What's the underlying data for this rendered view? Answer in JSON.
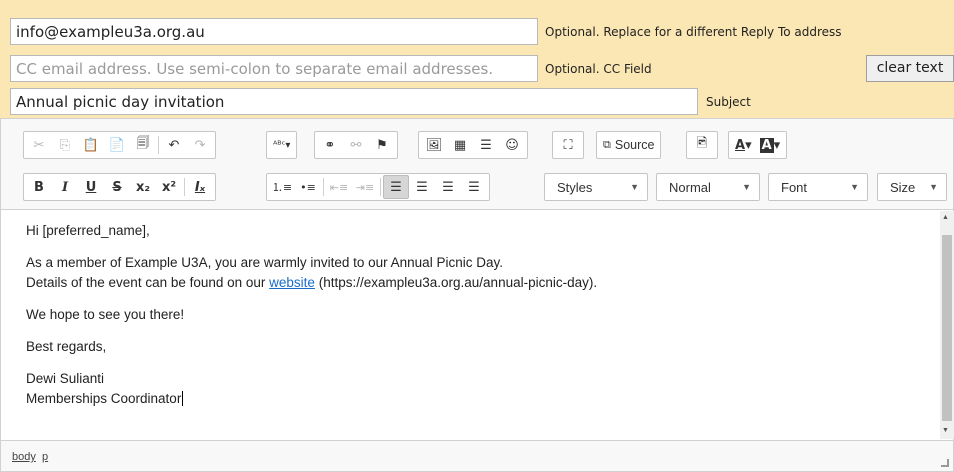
{
  "reply_to": {
    "value": "info@exampleu3a.org.au",
    "hint": "Optional. Replace for a different Reply To address"
  },
  "cc": {
    "placeholder": "CC email address. Use semi-colon to separate email addresses.",
    "hint": "Optional. CC Field"
  },
  "clear_button": "clear text",
  "subject": {
    "value": "Annual picnic day invitation",
    "hint": "Subject"
  },
  "toolbar": {
    "icons_row1": [
      "cut-icon",
      "copy-icon",
      "paste-icon",
      "paste-text-icon",
      "paste-word-icon",
      "undo-icon",
      "redo-icon",
      "spellcheck-icon",
      "link-icon",
      "unlink-icon",
      "anchor-icon",
      "image-icon",
      "table-icon",
      "horizontal-rule-icon",
      "smiley-icon",
      "maximize-icon",
      "source-icon",
      "image-edit-icon",
      "text-color-icon",
      "background-color-icon"
    ],
    "source_label": "Source",
    "icons_row2": [
      "bold-icon",
      "italic-icon",
      "underline-icon",
      "strike-icon",
      "subscript-icon",
      "superscript-icon",
      "remove-format-icon",
      "numbered-list-icon",
      "bulleted-list-icon",
      "outdent-icon",
      "indent-icon",
      "align-left-icon",
      "align-center-icon",
      "align-right-icon",
      "justify-icon"
    ],
    "styles_label": "Styles",
    "format_label": "Normal",
    "font_label": "Font",
    "size_label": "Size"
  },
  "content": {
    "greeting": "Hi [preferred_name],",
    "para1_line1": "As a member of Example U3A, you are warmly invited to our Annual Picnic Day.",
    "para1_line2_before": "Details of the event can be found on our ",
    "link_text": "website",
    "para1_line2_after": " (https://exampleu3a.org.au/annual-picnic-day).",
    "para2": "We hope to see you there!",
    "closing": "Best regards,",
    "signature_name": "Dewi Sulianti",
    "signature_title": "Memberships Coordinator"
  },
  "statusbar": {
    "path1": "body",
    "path2": "p"
  }
}
